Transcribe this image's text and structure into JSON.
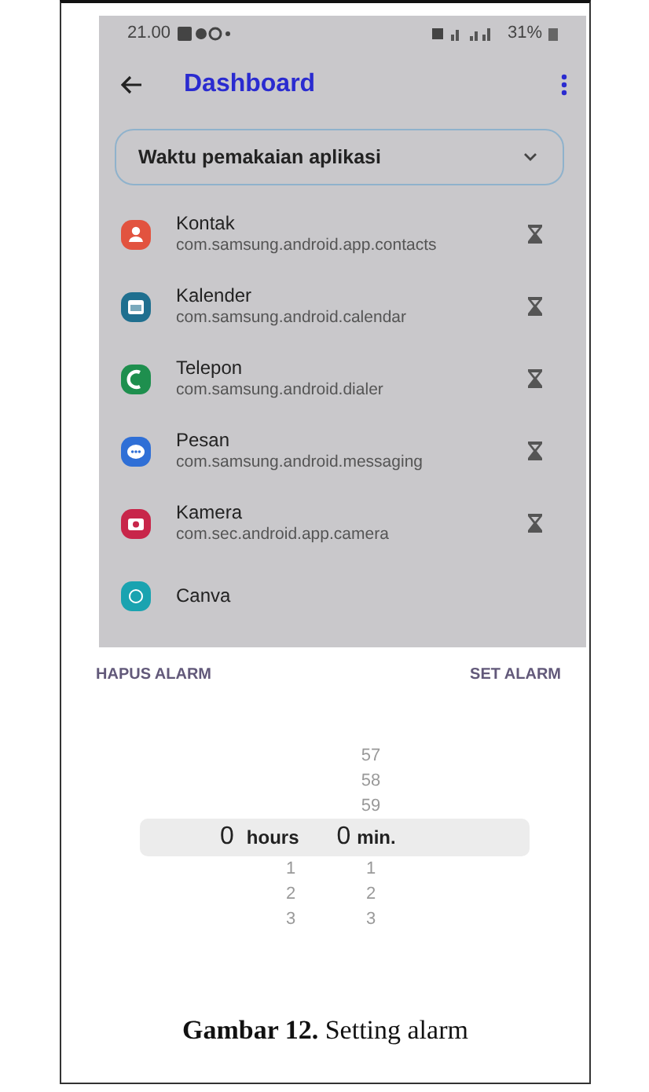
{
  "status_bar": {
    "time": "21.00",
    "battery": "31%"
  },
  "app_bar": {
    "title": "Dashboard"
  },
  "dropdown": {
    "value": "Waktu pemakaian aplikasi"
  },
  "apps": [
    {
      "kind": "contact",
      "name": "Kontak",
      "package": "com.samsung.android.app.contacts",
      "color": "#e2533f"
    },
    {
      "kind": "calendar",
      "name": "Kalender",
      "package": "com.samsung.android.calendar",
      "color": "#1f6f8f"
    },
    {
      "kind": "phone",
      "name": "Telepon",
      "package": "com.samsung.android.dialer",
      "color": "#1e8f4e"
    },
    {
      "kind": "chat",
      "name": "Pesan",
      "package": "com.samsung.android.messaging",
      "color": "#2f6fd6"
    },
    {
      "kind": "camera",
      "name": "Kamera",
      "package": "com.sec.android.app.camera",
      "color": "#c8264a"
    },
    {
      "kind": "canva",
      "name": "Canva",
      "color": "#1aa3b0"
    }
  ],
  "actions": [
    "HAPUS ALARM",
    "SET ALARM"
  ],
  "picker": {
    "hours": {
      "value": "0",
      "unit": "hours",
      "below": [
        "1",
        "2",
        "3"
      ]
    },
    "minutes": {
      "above": [
        "57",
        "58",
        "59"
      ],
      "value": "0",
      "unit": "min.",
      "below": [
        "1",
        "2",
        "3"
      ]
    }
  },
  "caption": "**Gambar 12.** Setting alarm"
}
